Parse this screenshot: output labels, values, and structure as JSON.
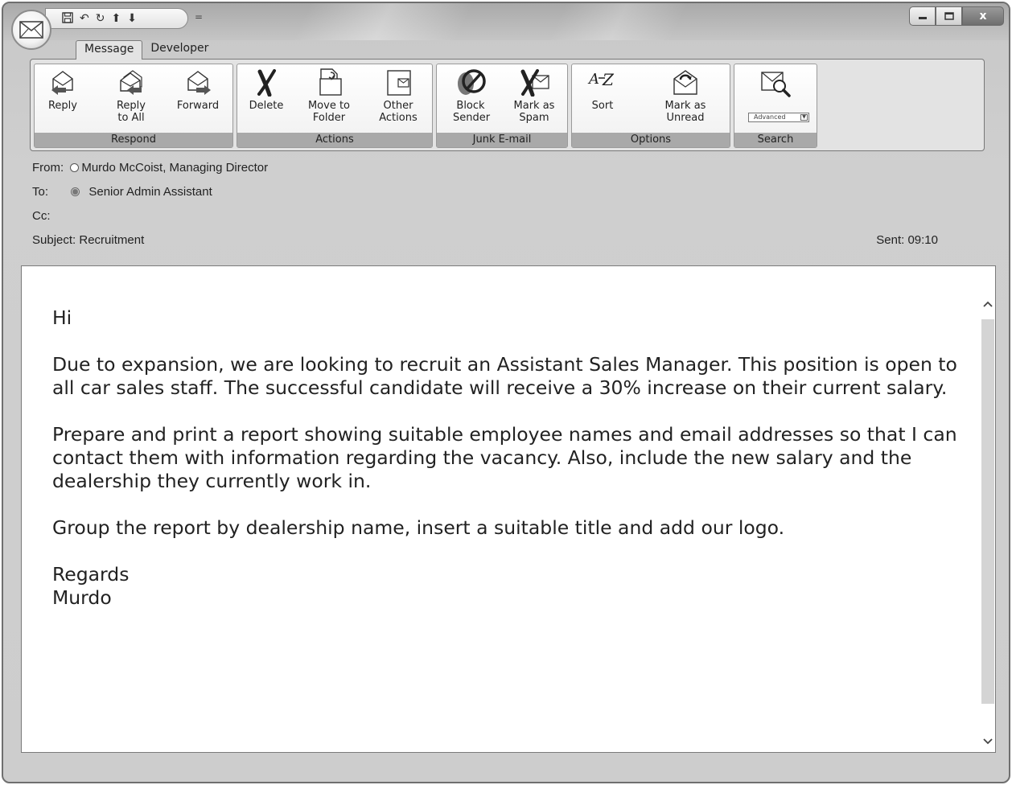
{
  "qat": {
    "save": "🖫",
    "undo": "↶",
    "redo": "↻",
    "up": "⬆",
    "down": "⬇",
    "customize": "="
  },
  "window_controls": {
    "minimize": "—",
    "maximize": "▢",
    "close": "x"
  },
  "tabs": [
    {
      "label": "Message"
    },
    {
      "label": "Developer"
    }
  ],
  "ribbon": {
    "respond": {
      "label": "Respond",
      "buttons": [
        {
          "label": "Reply",
          "icon": "reply-icon"
        },
        {
          "label": "Reply to All",
          "icon": "reply-all-icon"
        },
        {
          "label": "Forward",
          "icon": "forward-icon"
        }
      ]
    },
    "actions": {
      "label": "Actions",
      "buttons": [
        {
          "label": "Delete",
          "icon": "delete-icon"
        },
        {
          "label": "Move to Folder",
          "icon": "move-to-folder-icon"
        },
        {
          "label": "Other Actions",
          "icon": "other-actions-icon"
        }
      ]
    },
    "junk": {
      "label": "Junk E-mail",
      "buttons": [
        {
          "label": "Block Sender",
          "icon": "block-sender-icon"
        },
        {
          "label": "Mark as Spam",
          "icon": "mark-spam-icon"
        }
      ]
    },
    "options": {
      "label": "Options",
      "buttons": [
        {
          "label": "Sort",
          "icon": "sort-az-icon"
        },
        {
          "label": "Mark as Unread",
          "icon": "mark-unread-icon"
        }
      ]
    },
    "search": {
      "label": "Search",
      "advanced": "Advanced",
      "icon": "search-mail-icon"
    }
  },
  "email": {
    "from_label": "From:",
    "from_value": "Murdo McCoist, Managing Director",
    "to_label": "To:",
    "to_value": "Senior Admin Assistant",
    "cc_label": "Cc:",
    "subject_label": "Subject:",
    "subject_value": "Recruitment",
    "sent": "Sent: 09:10",
    "body": {
      "greeting": "Hi",
      "p1": "Due to expansion, we are looking to recruit an Assistant Sales Manager. This position is open to all car sales staff. The successful candidate will receive a 30% increase on their current salary.",
      "p2": "Prepare and print a report showing suitable employee names and email addresses so that I can contact them with information regarding the vacancy. Also, include the new salary and the dealership they currently work in.",
      "p3": "Group the report by dealership name, insert a suitable title and add our logo.",
      "signoff1": "Regards",
      "signoff2": "Murdo"
    }
  }
}
